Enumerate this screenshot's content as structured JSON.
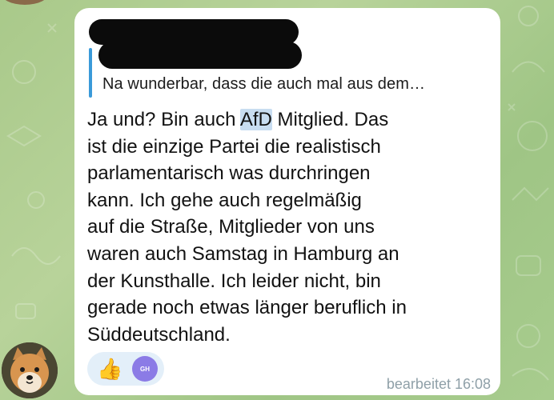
{
  "chat": {
    "reply": {
      "preview_text": "Na wunderbar, dass die auch mal aus dem…"
    },
    "message": {
      "lines": [
        {
          "before": "Ja und? Bin auch ",
          "highlight": "AfD",
          "after": " Mitglied. Das"
        },
        {
          "text": "ist die einzige Partei die realistisch"
        },
        {
          "text": "parlamentarisch was durchringen"
        },
        {
          "text": "kann. Ich gehe auch regelmäßig"
        },
        {
          "text": "auf die Straße, Mitglieder von uns"
        },
        {
          "text": "waren auch Samstag in Hamburg an"
        },
        {
          "text": "der Kunsthalle. Ich leider nicht, bin"
        },
        {
          "text": "gerade noch etwas länger beruflich in"
        },
        {
          "text": "Süddeutschland."
        }
      ]
    },
    "reactions": {
      "emoji": "👍",
      "reactor_initials": "GH"
    },
    "status": {
      "edited_label": "bearbeitet 16:08"
    }
  },
  "colors": {
    "bubble": "#ffffff",
    "reply_accent": "#3a9ad9",
    "highlight": "#c8ddf1",
    "reaction_bg": "#e3eff9",
    "reactor_avatar": "#8b7be6",
    "chat_background": "#a9c98a"
  }
}
